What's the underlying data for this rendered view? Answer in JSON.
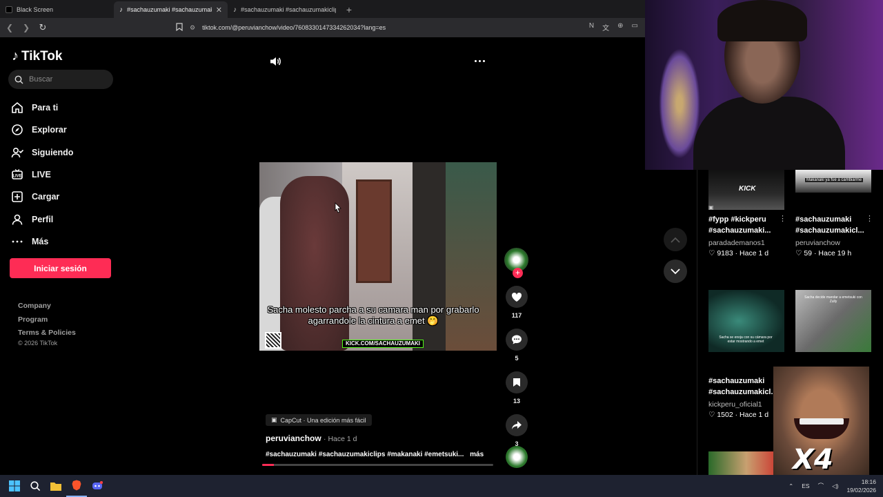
{
  "browser": {
    "tabs": [
      {
        "label": "Black Screen",
        "active": false
      },
      {
        "label": "#sachauzumaki #sachauzumakic",
        "active": true
      },
      {
        "label": "#sachauzumaki #sachauzumakiclips #",
        "active": false
      }
    ],
    "new_tab_label": "+",
    "url": "tiktok.com/@peruvianchow/video/7608330147334262034?lang=es"
  },
  "tiktok": {
    "brand": "TikTok",
    "search_placeholder": "Buscar",
    "menu": [
      {
        "label": "Para ti",
        "icon": "home-icon"
      },
      {
        "label": "Explorar",
        "icon": "compass-icon"
      },
      {
        "label": "Siguiendo",
        "icon": "following-icon"
      },
      {
        "label": "LIVE",
        "icon": "live-icon"
      },
      {
        "label": "Cargar",
        "icon": "upload-icon"
      },
      {
        "label": "Perfil",
        "icon": "profile-icon"
      },
      {
        "label": "Más",
        "icon": "more-icon"
      }
    ],
    "login_label": "Iniciar sesión",
    "footer_links": [
      "Company",
      "Program",
      "Terms & Policies"
    ],
    "copyright": "© 2026 TikTok",
    "accent": "#fe2c55"
  },
  "video": {
    "caption": "Sacha molesto parcha a su camara man por grabarlo agarrandole la cintura a emet 🤭",
    "watermark": "KICK.COM/SACHAUZUMAKI",
    "likes": "117",
    "comments": "5",
    "saves": "13",
    "shares": "3",
    "capcut_label": "CapCut · Una edición más fácil",
    "author": "peruvianchow",
    "time": "· Hace 1 d",
    "description": "#sachauzumaki #sachauzumakiclips #makanaki #emetsuki...",
    "more_label": "más",
    "progress": 0.05
  },
  "related": [
    {
      "title": "#fypp #kickperu #sachauzumaki...",
      "author": "paradademanos1",
      "likes": "9183",
      "time": "Hace 1 d",
      "thumb_text": "KICK"
    },
    {
      "title": "#sachauzumaki #sachauzumakicl...",
      "author": "peruvianchow",
      "likes": "59",
      "time": "Hace 19 h",
      "thumb_text": "Makanaki ya fue a cambiarme"
    },
    {
      "title": "",
      "author": "",
      "likes": "",
      "time": "",
      "thumb_text": "Sacha se enoja con su cámara por estar mostrando a emet"
    },
    {
      "title": "",
      "author": "",
      "likes": "",
      "time": "",
      "thumb_text": "Sacha decide mandar a emetsuki con Zully"
    },
    {
      "title": "#sachauzumaki #sachauzumakicl...",
      "author": "kickperu_oficial1",
      "likes": "1502",
      "time": "Hace 1 d",
      "thumb_text": ""
    }
  ],
  "meme_overlay": {
    "text": "X4"
  },
  "taskbar": {
    "lang": "ES",
    "time": "18:16",
    "date": "19/02/2026"
  }
}
